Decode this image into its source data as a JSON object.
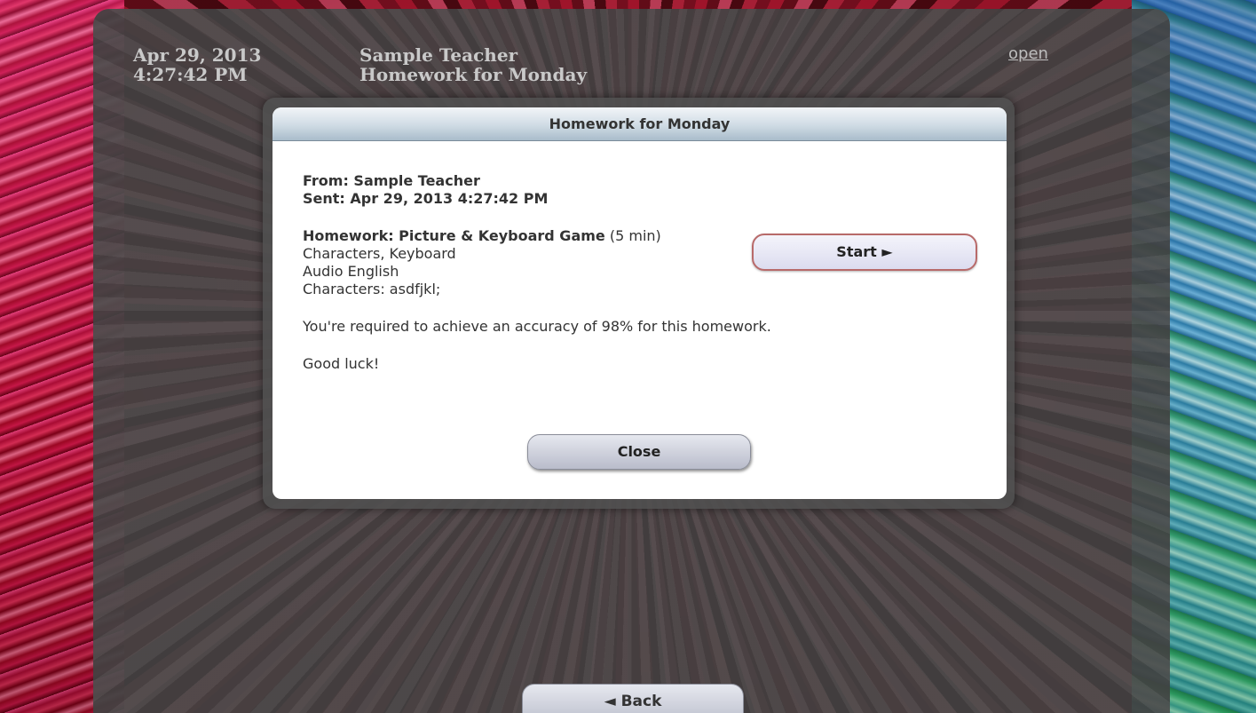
{
  "header": {
    "date": "Apr 29, 2013",
    "time": "4:27:42 PM",
    "teacher": "Sample Teacher",
    "subject": "Homework for Monday",
    "open_link": "open"
  },
  "modal": {
    "title": "Homework for Monday",
    "from": "From: Sample Teacher",
    "sent": "Sent: Apr 29, 2013 4:27:42 PM",
    "homework_name": "Homework: Picture & Keyboard Game",
    "duration": " (5 min)",
    "detail_lines": [
      "Characters, Keyboard",
      "Audio English",
      "Characters: asdfjkl;"
    ],
    "requirement": "You're required to achieve an accuracy of 98% for this homework.",
    "sign_off": "Good luck!",
    "start_label": "Start ►",
    "close_label": "Close"
  },
  "footer": {
    "back_label": "◄ Back"
  }
}
